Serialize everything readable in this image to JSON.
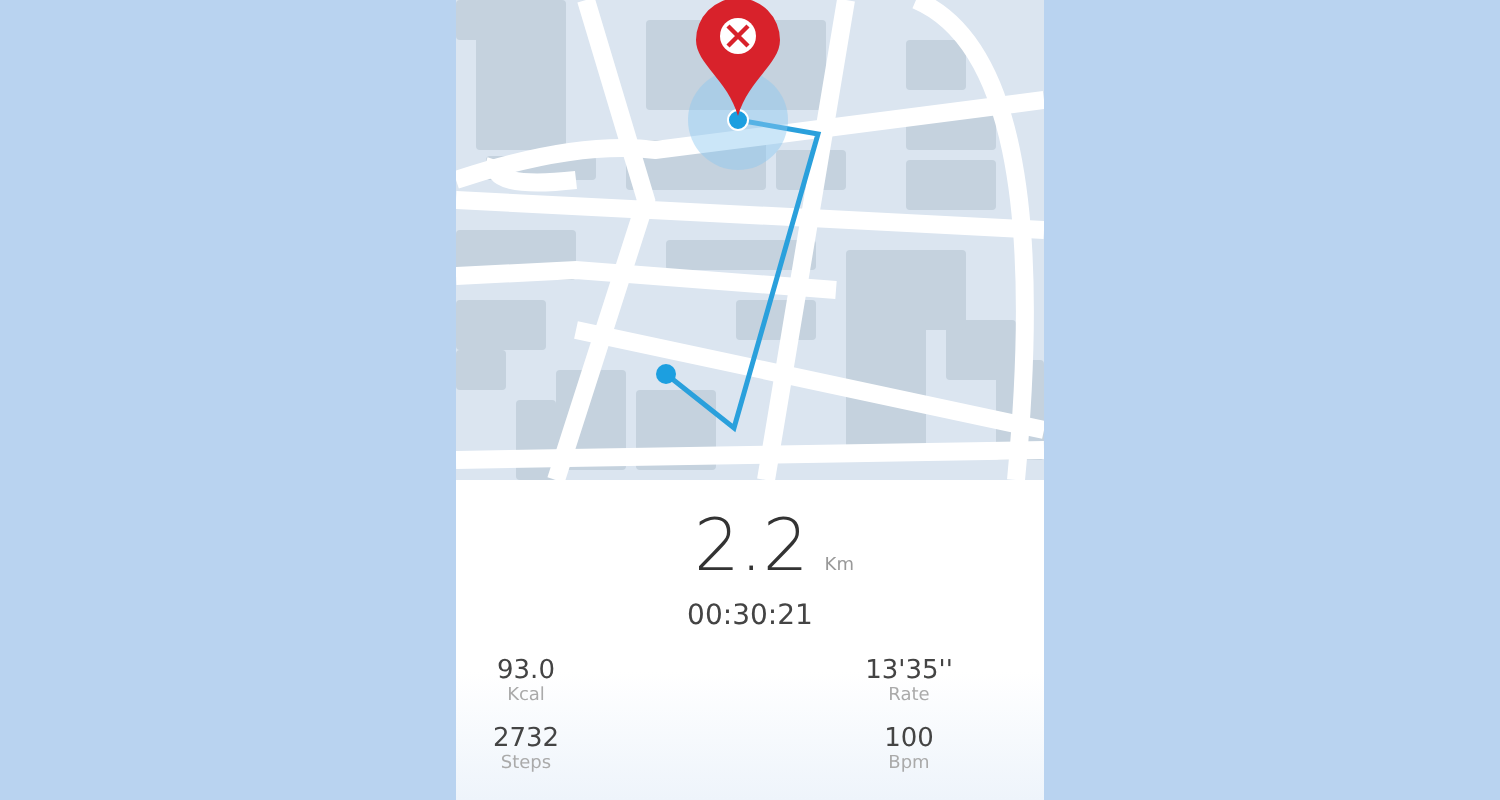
{
  "summary": {
    "distance": "2.2",
    "unit": "Km",
    "duration": "00:30:21"
  },
  "stats": [
    {
      "value": "93.0",
      "label": "Kcal"
    },
    {
      "value": "13'35''",
      "label": "Rate"
    },
    {
      "value": "2732",
      "label": "Steps"
    },
    {
      "value": "100",
      "label": "Bpm"
    }
  ]
}
